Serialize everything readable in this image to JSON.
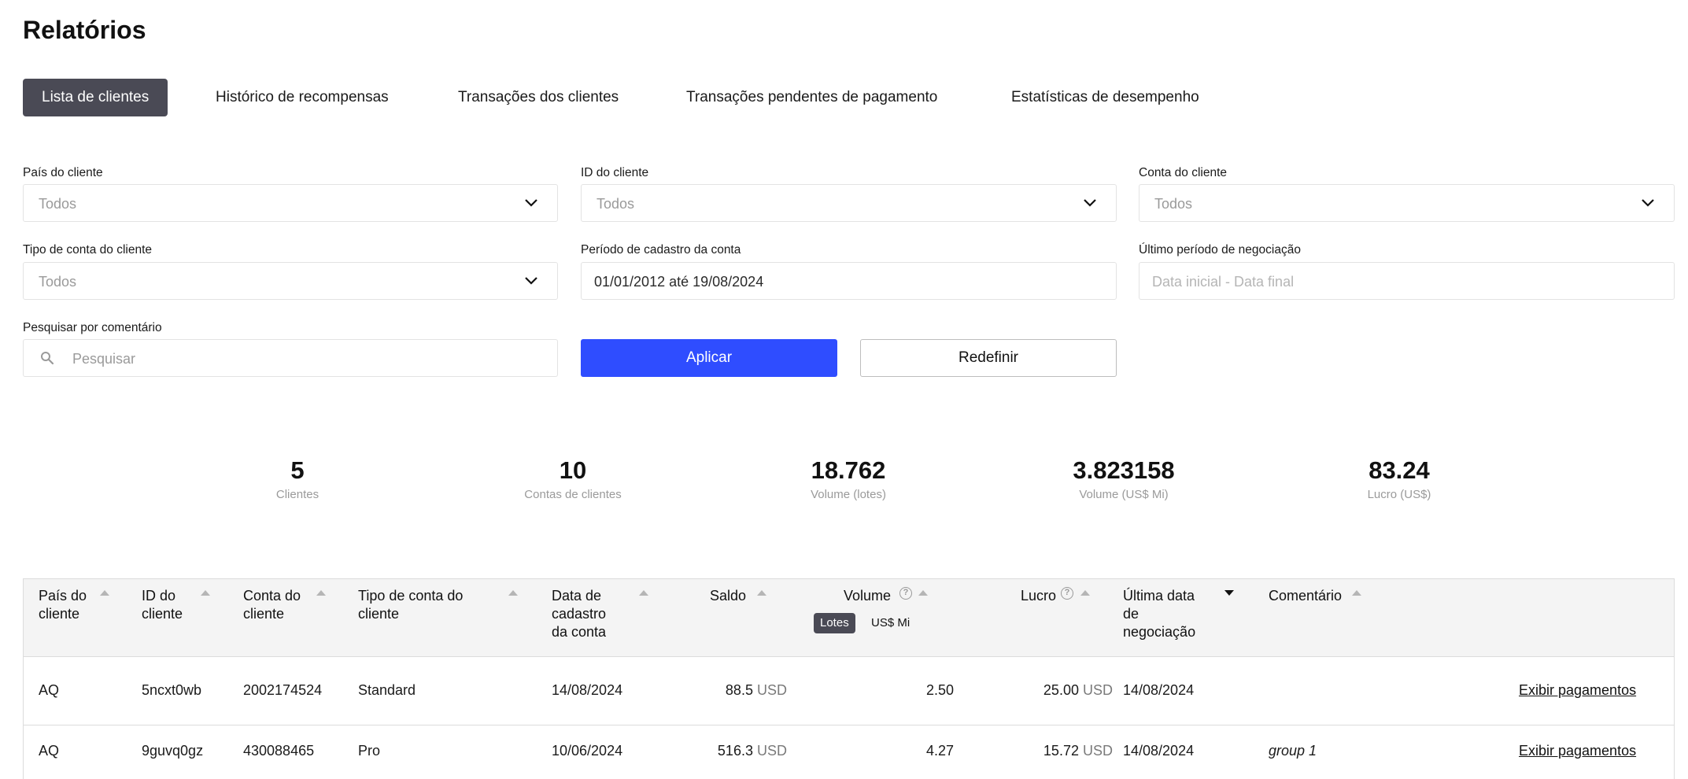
{
  "page": {
    "title": "Relatórios"
  },
  "tabs": [
    {
      "label": "Lista de clientes",
      "active": true
    },
    {
      "label": "Histórico de recompensas",
      "active": false
    },
    {
      "label": "Transações dos clientes",
      "active": false
    },
    {
      "label": "Transações pendentes de pagamento",
      "active": false
    },
    {
      "label": "Estatísticas de desempenho",
      "active": false
    }
  ],
  "filters": {
    "country": {
      "label": "País do cliente",
      "value": "Todos"
    },
    "client_id": {
      "label": "ID do cliente",
      "value": "Todos"
    },
    "account": {
      "label": "Conta do cliente",
      "value": "Todos"
    },
    "account_type": {
      "label": "Tipo de conta do cliente",
      "value": "Todos"
    },
    "registration_period": {
      "label": "Período de cadastro da conta",
      "value": "01/01/2012 até 19/08/2024"
    },
    "last_trade_period": {
      "label": "Último período de negociação",
      "placeholder": "Data inicial - Data final"
    },
    "comment_search": {
      "label": "Pesquisar por comentário",
      "placeholder": "Pesquisar"
    },
    "apply_label": "Aplicar",
    "reset_label": "Redefinir"
  },
  "stats": [
    {
      "value": "5",
      "label": "Clientes"
    },
    {
      "value": "10",
      "label": "Contas de clientes"
    },
    {
      "value": "18.762",
      "label": "Volume (lotes)"
    },
    {
      "value": "3.823158",
      "label": "Volume (US$ Mi)"
    },
    {
      "value": "83.24",
      "label": "Lucro (US$)"
    }
  ],
  "table": {
    "columns": [
      {
        "key": "country",
        "label": "País do cliente"
      },
      {
        "key": "client_id",
        "label": "ID do cliente"
      },
      {
        "key": "account",
        "label": "Conta do cliente"
      },
      {
        "key": "account_type",
        "label": "Tipo de conta do cliente"
      },
      {
        "key": "registration_date",
        "label": "Data de cadastro da conta"
      },
      {
        "key": "balance",
        "label": "Saldo"
      },
      {
        "key": "volume",
        "label": "Volume"
      },
      {
        "key": "profit",
        "label": "Lucro"
      },
      {
        "key": "last_trade_date",
        "label": "Última data de negociação"
      },
      {
        "key": "comment",
        "label": "Comentário"
      }
    ],
    "volume_units": {
      "lots": "Lotes",
      "usd_mi": "US$ Mi",
      "selected": "Lotes"
    },
    "help_glyph": "?",
    "currency": "USD",
    "rows": [
      {
        "country": "AQ",
        "client_id": "5ncxt0wb",
        "account": "2002174524",
        "account_type": "Standard",
        "registration_date": "14/08/2024",
        "balance": "88.5",
        "balance_unit": "USD",
        "volume": "2.50",
        "profit": "25.00",
        "profit_unit": "USD",
        "last_trade_date": "14/08/2024",
        "comment": "",
        "action": "Exibir pagamentos"
      },
      {
        "country": "AQ",
        "client_id": "9guvq0gz",
        "account": "430088465",
        "account_type": "Pro",
        "registration_date": "10/06/2024",
        "balance": "516.3",
        "balance_unit": "USD",
        "volume": "4.27",
        "profit": "15.72",
        "profit_unit": "USD",
        "last_trade_date": "14/08/2024",
        "comment": "group 1",
        "action": "Exibir pagamentos"
      }
    ]
  }
}
